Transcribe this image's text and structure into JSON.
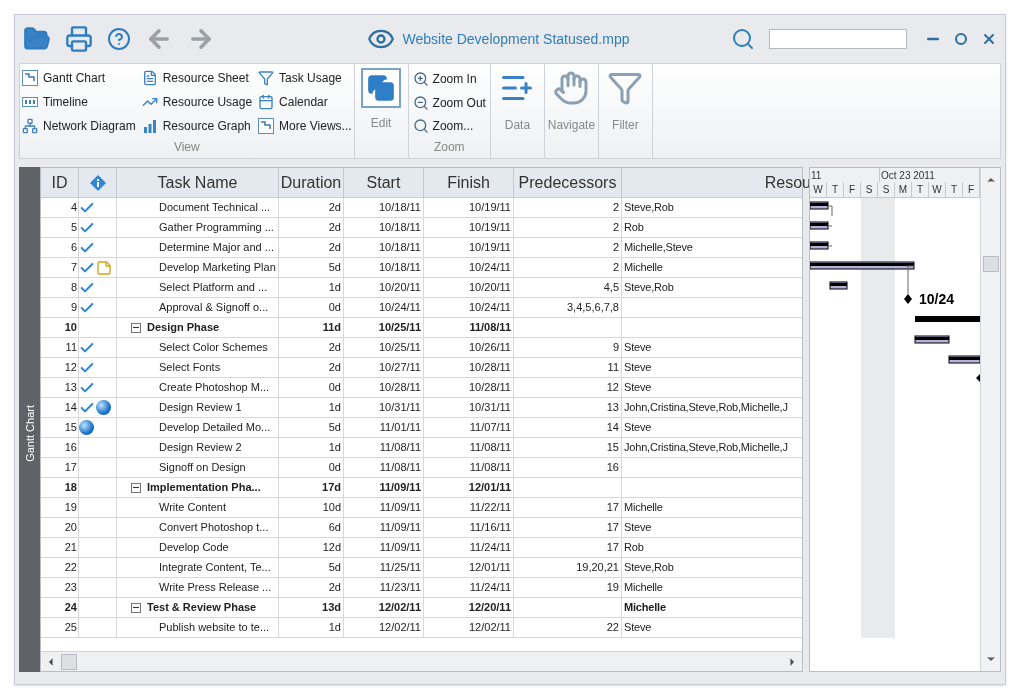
{
  "window": {
    "title": "Website Development Statused.mpp"
  },
  "ribbon": {
    "view_group": {
      "label": "View",
      "columns": [
        [
          {
            "kind": "gantt",
            "label": "Gantt Chart"
          },
          {
            "kind": "timeline",
            "label": "Timeline"
          },
          {
            "kind": "network",
            "label": "Network Diagram"
          }
        ],
        [
          {
            "kind": "sheet",
            "label": "Resource Sheet"
          },
          {
            "kind": "usage",
            "label": "Resource Usage"
          },
          {
            "kind": "graph",
            "label": "Resource Graph"
          }
        ],
        [
          {
            "kind": "funnel",
            "label": "Task Usage"
          },
          {
            "kind": "calendar",
            "label": "Calendar"
          },
          {
            "kind": "gantt",
            "label": "More Views..."
          }
        ]
      ]
    },
    "edit_button": {
      "label": "Edit"
    },
    "zoom_group": {
      "label": "Zoom",
      "items": [
        {
          "kind": "in",
          "label": "Zoom In"
        },
        {
          "kind": "out",
          "label": "Zoom Out"
        },
        {
          "kind": "zoom",
          "label": "Zoom..."
        }
      ]
    },
    "big_buttons": [
      {
        "kind": "data",
        "label": "Data"
      },
      {
        "kind": "navigate",
        "label": "Navigate"
      },
      {
        "kind": "filter",
        "label": "Filter"
      }
    ]
  },
  "side_tab": {
    "label": "Gantt Chart"
  },
  "table": {
    "columns": [
      "ID",
      "",
      "Task Name",
      "Duration",
      "Start",
      "Finish",
      "Predecessors",
      "Resou"
    ],
    "rows": [
      {
        "id": "4",
        "kind": "task",
        "indicators": [
          {
            "kind": "check"
          }
        ],
        "name": "Document Technical ...",
        "duration": "2d",
        "start": "10/18/11",
        "finish": "10/19/11",
        "predecessors": "2",
        "resources": "Steve,Rob"
      },
      {
        "id": "5",
        "kind": "task",
        "indicators": [
          {
            "kind": "check"
          }
        ],
        "name": "Gather Programming ...",
        "duration": "2d",
        "start": "10/18/11",
        "finish": "10/19/11",
        "predecessors": "2",
        "resources": "Rob"
      },
      {
        "id": "6",
        "kind": "task",
        "indicators": [
          {
            "kind": "check"
          }
        ],
        "name": "Determine Major and ...",
        "duration": "2d",
        "start": "10/18/11",
        "finish": "10/19/11",
        "predecessors": "2",
        "resources": "Michelle,Steve"
      },
      {
        "id": "7",
        "kind": "task",
        "indicators": [
          {
            "kind": "check"
          },
          {
            "kind": "note"
          }
        ],
        "name": "Develop Marketing Plan",
        "duration": "5d",
        "start": "10/18/11",
        "finish": "10/24/11",
        "predecessors": "2",
        "resources": "Michelle"
      },
      {
        "id": "8",
        "kind": "task",
        "indicators": [
          {
            "kind": "check"
          }
        ],
        "name": "Select Platform and ...",
        "duration": "1d",
        "start": "10/20/11",
        "finish": "10/20/11",
        "predecessors": "4,5",
        "resources": "Steve,Rob"
      },
      {
        "id": "9",
        "kind": "task",
        "indicators": [
          {
            "kind": "check"
          }
        ],
        "name": "Approval & Signoff o...",
        "duration": "0d",
        "start": "10/24/11",
        "finish": "10/24/11",
        "predecessors": "3,4,5,6,7,8",
        "resources": ""
      },
      {
        "id": "10",
        "kind": "summary",
        "expanded": true,
        "indicators": [],
        "name": "Design Phase",
        "duration": "11d",
        "start": "10/25/11",
        "finish": "11/08/11",
        "predecessors": "",
        "resources": ""
      },
      {
        "id": "11",
        "kind": "task",
        "indicators": [
          {
            "kind": "check"
          }
        ],
        "name": "Select Color Schemes",
        "duration": "2d",
        "start": "10/25/11",
        "finish": "10/26/11",
        "predecessors": "9",
        "resources": "Steve"
      },
      {
        "id": "12",
        "kind": "task",
        "indicators": [
          {
            "kind": "check"
          }
        ],
        "name": "Select Fonts",
        "duration": "2d",
        "start": "10/27/11",
        "finish": "10/28/11",
        "predecessors": "11",
        "resources": "Steve"
      },
      {
        "id": "13",
        "kind": "task",
        "indicators": [
          {
            "kind": "check"
          }
        ],
        "name": "Create Photoshop M...",
        "duration": "0d",
        "start": "10/28/11",
        "finish": "10/28/11",
        "predecessors": "12",
        "resources": "Steve"
      },
      {
        "id": "14",
        "kind": "task",
        "indicators": [
          {
            "kind": "check"
          },
          {
            "kind": "globe"
          }
        ],
        "name": "Design Review 1",
        "duration": "1d",
        "start": "10/31/11",
        "finish": "10/31/11",
        "predecessors": "13",
        "resources": "John,Cristina,Steve,Rob,Michelle,J"
      },
      {
        "id": "15",
        "kind": "task",
        "indicators": [
          {
            "kind": "globe"
          }
        ],
        "name": "Develop Detailed Mo...",
        "duration": "5d",
        "start": "11/01/11",
        "finish": "11/07/11",
        "predecessors": "14",
        "resources": "Steve"
      },
      {
        "id": "16",
        "kind": "task",
        "indicators": [],
        "name": "Design Review 2",
        "duration": "1d",
        "start": "11/08/11",
        "finish": "11/08/11",
        "predecessors": "15",
        "resources": "John,Cristina,Steve,Rob,Michelle,J"
      },
      {
        "id": "17",
        "kind": "task",
        "indicators": [],
        "name": "Signoff on Design",
        "duration": "0d",
        "start": "11/08/11",
        "finish": "11/08/11",
        "predecessors": "16",
        "resources": ""
      },
      {
        "id": "18",
        "kind": "summary",
        "expanded": true,
        "indicators": [],
        "name": "Implementation Pha...",
        "duration": "17d",
        "start": "11/09/11",
        "finish": "12/01/11",
        "predecessors": "",
        "resources": ""
      },
      {
        "id": "19",
        "kind": "task",
        "indicators": [],
        "name": "Write Content",
        "duration": "10d",
        "start": "11/09/11",
        "finish": "11/22/11",
        "predecessors": "17",
        "resources": "Michelle"
      },
      {
        "id": "20",
        "kind": "task",
        "indicators": [],
        "name": "Convert Photoshop t...",
        "duration": "6d",
        "start": "11/09/11",
        "finish": "11/16/11",
        "predecessors": "17",
        "resources": "Steve"
      },
      {
        "id": "21",
        "kind": "task",
        "indicators": [],
        "name": "Develop Code",
        "duration": "12d",
        "start": "11/09/11",
        "finish": "11/24/11",
        "predecessors": "17",
        "resources": "Rob"
      },
      {
        "id": "22",
        "kind": "task",
        "indicators": [],
        "name": "Integrate Content, Te...",
        "duration": "5d",
        "start": "11/25/11",
        "finish": "12/01/11",
        "predecessors": "19,20,21",
        "resources": "Steve,Rob"
      },
      {
        "id": "23",
        "kind": "task",
        "indicators": [],
        "name": "Write Press Release ...",
        "duration": "2d",
        "start": "11/23/11",
        "finish": "11/24/11",
        "predecessors": "19",
        "resources": "Michelle"
      },
      {
        "id": "24",
        "kind": "summary",
        "expanded": true,
        "indicators": [],
        "name": "Test & Review Phase",
        "duration": "13d",
        "start": "12/02/11",
        "finish": "12/20/11",
        "predecessors": "",
        "resources": "Michelle"
      },
      {
        "id": "25",
        "kind": "task",
        "indicators": [],
        "name": "Publish website to te...",
        "duration": "1d",
        "start": "12/02/11",
        "finish": "12/02/11",
        "predecessors": "22",
        "resources": "Steve"
      }
    ]
  },
  "gantt": {
    "weeks": [
      "11",
      "Oct 23 2011"
    ],
    "days": [
      "W",
      "T",
      "F",
      "S",
      "S",
      "M",
      "T",
      "W",
      "T",
      "F"
    ],
    "milestone_label": "10/24"
  }
}
